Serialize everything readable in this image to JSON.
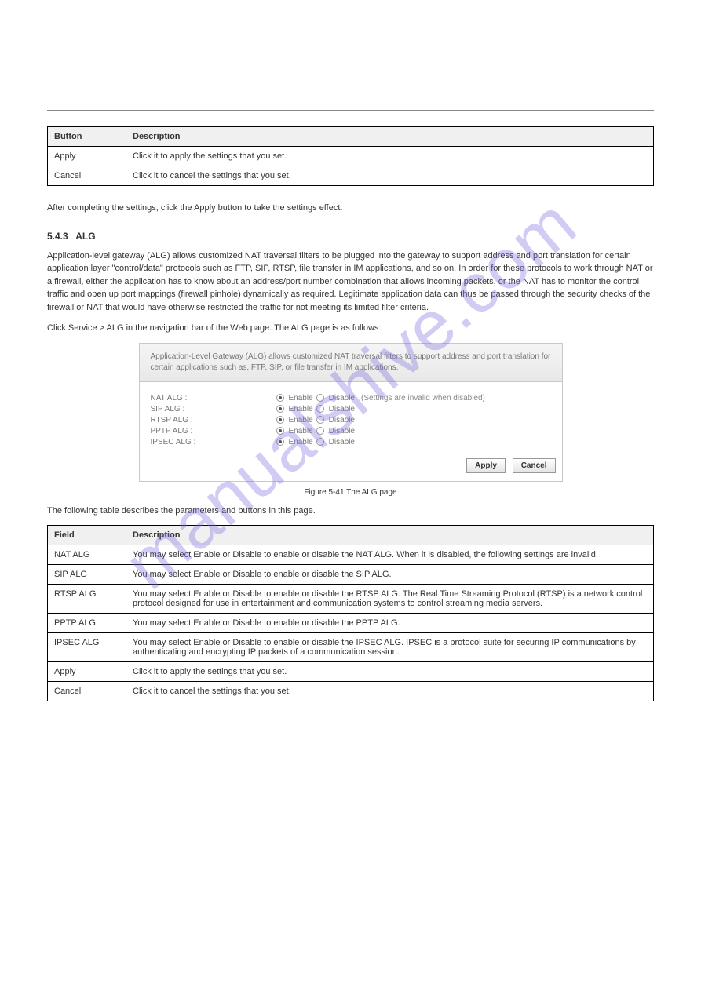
{
  "watermark": "manualshive.com",
  "table1": {
    "headers": [
      "Button",
      "Description"
    ],
    "rows": [
      [
        "Apply",
        "Click it to apply the settings that you set."
      ],
      [
        "Cancel",
        "Click it to cancel the settings that you set."
      ]
    ]
  },
  "section": {
    "number": "5.4.3",
    "title": "ALG"
  },
  "para1": "After completing the settings, click the Apply button to take the settings effect.",
  "para2_part1": "Application-level gateway (ALG) allows customized NAT traversal filters to be plugged into the gateway to support address and port translation for certain application layer \"control/data\" protocols such as FTP, SIP, RTSP, file transfer in IM applications, and so on. In order for these protocols to work through NAT or a firewall, either the application has to know about an address/port number combination that allows incoming packets, or the NAT has to monitor the control traffic and open up port mappings (firewall pinhole) dynamically as required. Legitimate application data can thus be passed through the security checks of the firewall or NAT that would have otherwise restricted the traffic for not meeting its limited filter criteria.",
  "para3": "Click Service > ALG in the navigation bar of the Web page. The ALG page is as follows:",
  "ui": {
    "description": "Application-Level Gateway (ALG) allows customized NAT traversal filters to support address and port translation for certain applications such as, FTP, SIP, or file transfer in IM applications.",
    "rows": [
      {
        "label": "NAT ALG :",
        "enable": "Enable",
        "disable": "Disable",
        "hint": "(Settings are invalid when disabled)"
      },
      {
        "label": "SIP ALG :",
        "enable": "Enable",
        "disable": "Disable",
        "hint": ""
      },
      {
        "label": "RTSP ALG :",
        "enable": "Enable",
        "disable": "Disable",
        "hint": ""
      },
      {
        "label": "PPTP ALG :",
        "enable": "Enable",
        "disable": "Disable",
        "hint": ""
      },
      {
        "label": "IPSEC ALG :",
        "enable": "Enable",
        "disable": "Disable",
        "hint": ""
      }
    ],
    "apply": "Apply",
    "cancel": "Cancel"
  },
  "figure_caption": "Figure 5-41 The ALG page",
  "table2_caption": "The following table describes the parameters and buttons in this page.",
  "table2": {
    "headers": [
      "Field",
      "Description"
    ],
    "rows": [
      [
        "NAT ALG",
        "You may select Enable or Disable to enable or disable the NAT ALG. When it is disabled, the following settings are invalid."
      ],
      [
        "SIP ALG",
        "You may select Enable or Disable to enable or disable the SIP ALG."
      ],
      [
        "RTSP ALG",
        "You may select Enable or Disable to enable or disable the RTSP ALG. The Real Time Streaming Protocol (RTSP) is a network control protocol designed for use in entertainment and communication systems to control streaming media servers."
      ],
      [
        "PPTP ALG",
        "You may select Enable or Disable to enable or disable the PPTP ALG."
      ],
      [
        "IPSEC ALG",
        "You may select Enable or Disable to enable or disable the IPSEC ALG. IPSEC is a protocol suite for securing IP communications by authenticating and encrypting IP packets of a communication session."
      ],
      [
        "Apply",
        "Click it to apply the settings that you set."
      ],
      [
        "Cancel",
        "Click it to cancel the settings that you set."
      ]
    ]
  }
}
